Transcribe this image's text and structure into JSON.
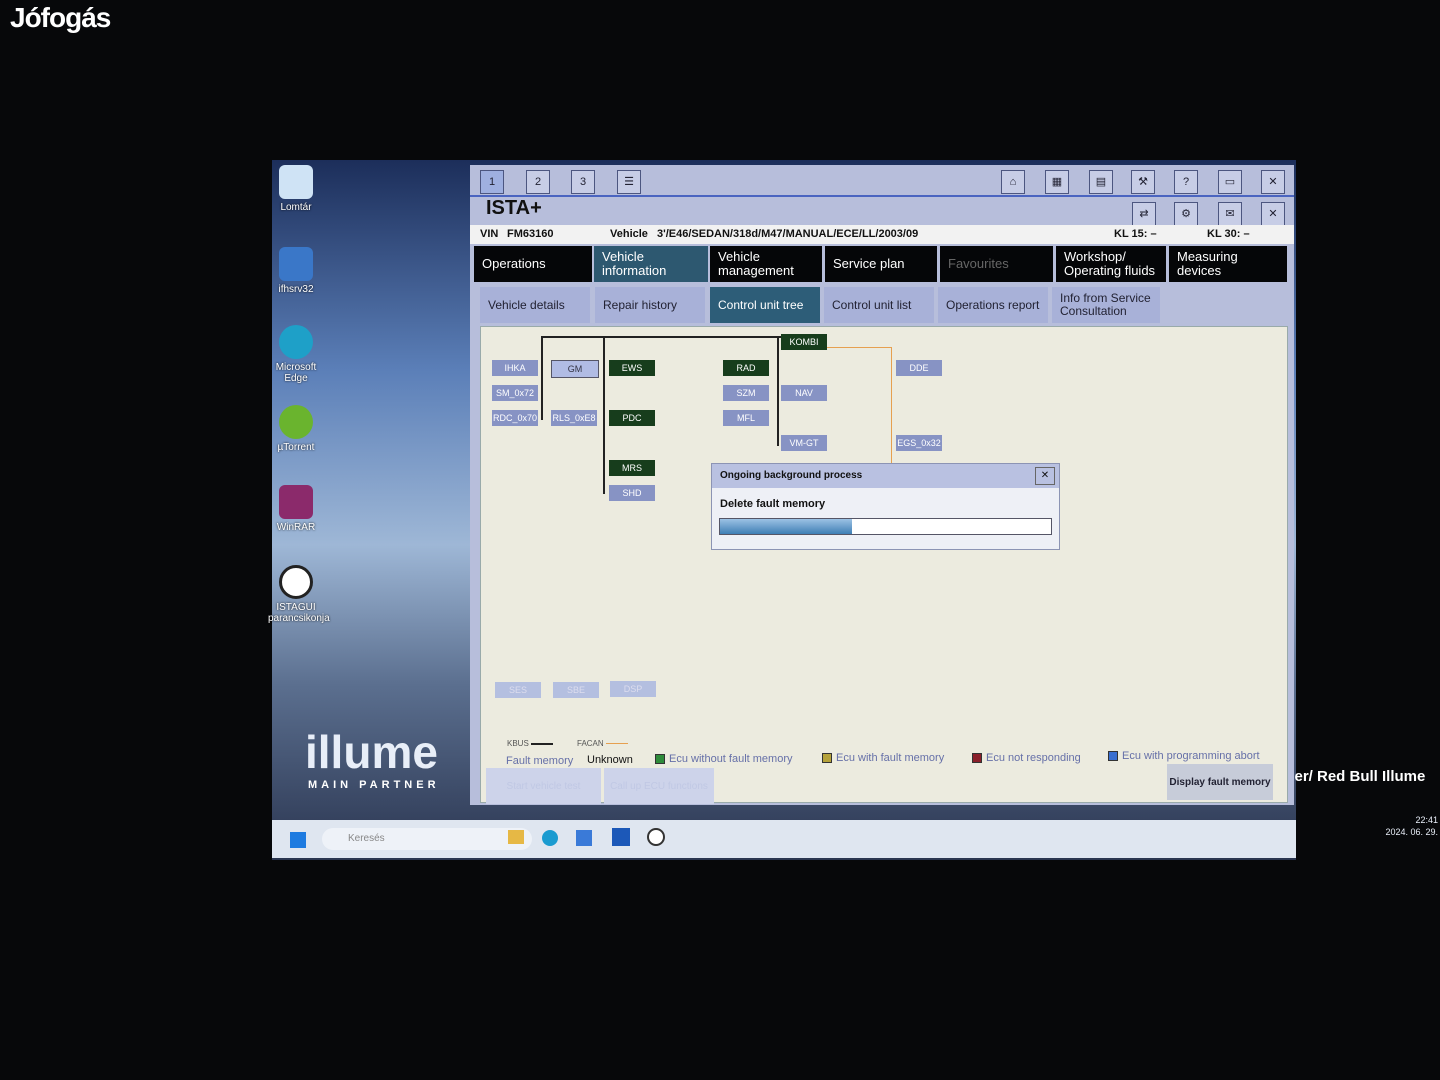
{
  "watermark": "Jófogás",
  "desktop": {
    "icons": [
      "Lomtár",
      "ifhsrv32",
      "Microsoft Edge",
      "µTorrent",
      "WinRAR",
      "ISTAGUI parancsikonja"
    ],
    "wallpaper_logo": "illume",
    "wallpaper_sub": "MAIN PARTNER",
    "wallpaper_caption": "tzer/ Red Bull Illume"
  },
  "app": {
    "title": "ISTA+",
    "tabs": [
      "1",
      "2",
      "3"
    ],
    "toolbar_icons": [
      "home-icon",
      "vehicle-icon",
      "print-icon",
      "wrench-icon",
      "help-icon",
      "minimize-icon",
      "close-icon"
    ],
    "vin_label": "VIN",
    "vin": "FM63160",
    "vehicle_label": "Vehicle",
    "vehicle": "3'/E46/SEDAN/318d/M47/MANUAL/ECE/LL/2003/09",
    "kl15": "KL 15:  –",
    "kl30": "KL 30:  –",
    "nav": [
      "Operations",
      "Vehicle information",
      "Vehicle management",
      "Service plan",
      "Favourites",
      "Workshop/ Operating fluids",
      "Measuring devices"
    ],
    "active_nav": "Vehicle information",
    "subnav": [
      "Vehicle details",
      "Repair history",
      "Control unit tree",
      "Control unit list",
      "Operations report",
      "Info from Service Consultation"
    ],
    "active_subnav": "Control unit tree",
    "ecus": [
      {
        "label": "IHKA",
        "status": "programming abort"
      },
      {
        "label": "GM"
      },
      {
        "label": "EWS",
        "status": "without fault"
      },
      {
        "label": "SM_0x72"
      },
      {
        "label": "RDC_0x70"
      },
      {
        "label": "RLS_0xE8"
      },
      {
        "label": "PDC",
        "status": "without fault"
      },
      {
        "label": "MRS",
        "status": "without fault"
      },
      {
        "label": "SHD"
      },
      {
        "label": "KOMBI",
        "status": "without fault"
      },
      {
        "label": "RAD",
        "status": "without fault"
      },
      {
        "label": "SZM"
      },
      {
        "label": "NAV"
      },
      {
        "label": "MFL"
      },
      {
        "label": "VM-GT"
      },
      {
        "label": "DDE"
      },
      {
        "label": "EGS_0x32"
      },
      {
        "label": "SES"
      },
      {
        "label": "SBE"
      },
      {
        "label": "DSP"
      }
    ],
    "bus_legend": {
      "kbus": "KBUS",
      "facan": "FACAN"
    },
    "fault_memory_label": "Fault memory",
    "fault_memory_value": "Unknown",
    "legend": [
      "Ecu without fault memory",
      "Ecu with fault memory",
      "Ecu not responding",
      "Ecu with programming abort"
    ],
    "legend_colors": [
      "#2e8b3a",
      "#b5a23a",
      "#8a1f2a",
      "#3a6fd0"
    ],
    "buttons": {
      "start_test": "Start vehicle test",
      "call_ecu": "Call up ECU functions",
      "display_fault": "Display fault memory"
    },
    "dialog": {
      "title": "Ongoing background process",
      "message": "Delete fault memory",
      "progress": 0.4
    }
  },
  "taskbar": {
    "search": "Keresés",
    "time": "22:41",
    "date": "2024. 06. 29."
  }
}
